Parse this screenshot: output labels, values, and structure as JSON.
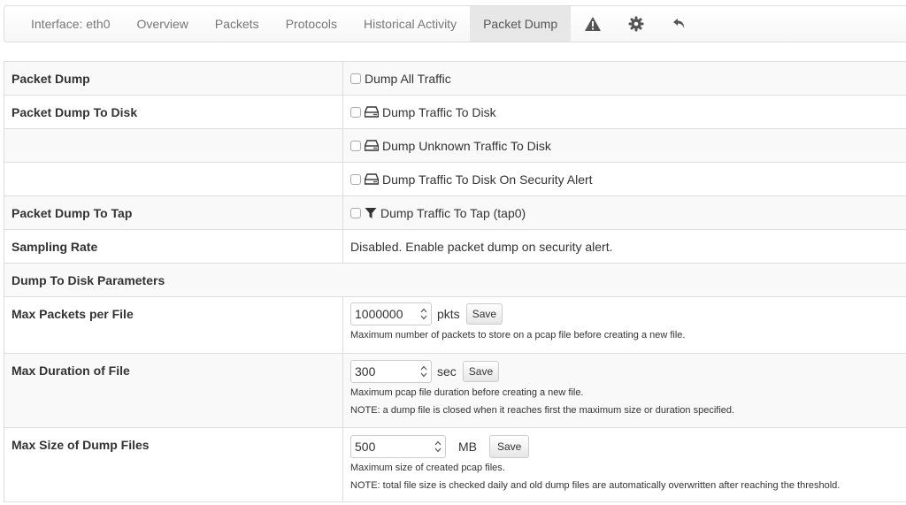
{
  "nav": {
    "items": [
      {
        "label": "Interface: eth0"
      },
      {
        "label": "Overview"
      },
      {
        "label": "Packets"
      },
      {
        "label": "Protocols"
      },
      {
        "label": "Historical Activity"
      },
      {
        "label": "Packet Dump"
      }
    ],
    "icons": [
      "warning-icon",
      "gear-icon",
      "undo-icon"
    ]
  },
  "rows": {
    "packet_dump": {
      "label": "Packet Dump",
      "option": "Dump All Traffic"
    },
    "packet_dump_to_disk": {
      "label": "Packet Dump To Disk",
      "options": [
        "Dump Traffic To Disk",
        "Dump Unknown Traffic To Disk",
        "Dump Traffic To Disk On Security Alert"
      ]
    },
    "packet_dump_to_tap": {
      "label": "Packet Dump To Tap",
      "option": "Dump Traffic To Tap (tap0)"
    },
    "sampling_rate": {
      "label": "Sampling Rate",
      "value": "Disabled. Enable packet dump on security alert."
    }
  },
  "section": {
    "title": "Dump To Disk Parameters"
  },
  "params": {
    "max_packets": {
      "label": "Max Packets per File",
      "value": "1000000",
      "unit": "pkts",
      "save": "Save",
      "help": "Maximum number of packets to store on a pcap file before creating a new file."
    },
    "max_duration": {
      "label": "Max Duration of File",
      "value": "300",
      "unit": "sec",
      "save": "Save",
      "help": "Maximum pcap file duration before creating a new file.",
      "note": "NOTE: a dump file is closed when it reaches first the maximum size or duration specified."
    },
    "max_size": {
      "label": "Max Size of Dump Files",
      "value": "500",
      "unit": "MB",
      "save": "Save",
      "help": "Maximum size of created pcap files.",
      "note": "NOTE: total file size is checked daily and old dump files are automatically overwritten after reaching the threshold."
    }
  }
}
